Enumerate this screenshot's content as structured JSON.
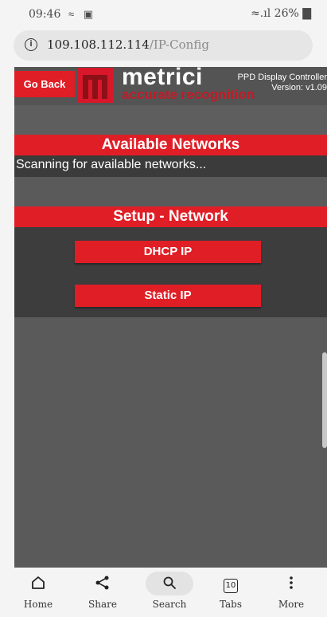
{
  "status_bar": {
    "time": "09:46",
    "left_icons": "≈ ▣",
    "right": "≈.ıl 26% ▇"
  },
  "url_bar": {
    "host": "109.108.112.114",
    "path": "/IP-Config",
    "info_icon": "i"
  },
  "header": {
    "go_back_label": "Go Back",
    "brand": "metrici",
    "tagline": "accurate recognition",
    "product_line1": "PPD Display Controller",
    "product_line2": "Version: v1.09"
  },
  "available_networks": {
    "title": "Available Networks",
    "status": "Scanning for available networks..."
  },
  "setup_network": {
    "title": "Setup - Network",
    "dhcp_label": "DHCP IP",
    "static_label": "Static IP"
  },
  "bottom_nav": {
    "items": [
      {
        "label": "Home",
        "icon": "home-icon"
      },
      {
        "label": "Share",
        "icon": "share-icon"
      },
      {
        "label": "Search",
        "icon": "search-icon"
      },
      {
        "label": "Tabs",
        "icon": "tabs-icon",
        "count": "10"
      },
      {
        "label": "More",
        "icon": "more-vertical-icon"
      }
    ]
  },
  "colors": {
    "accent_red": "#e01e26",
    "page_bg": "#5a5a5a",
    "panel_dark": "#3d3d3d"
  }
}
